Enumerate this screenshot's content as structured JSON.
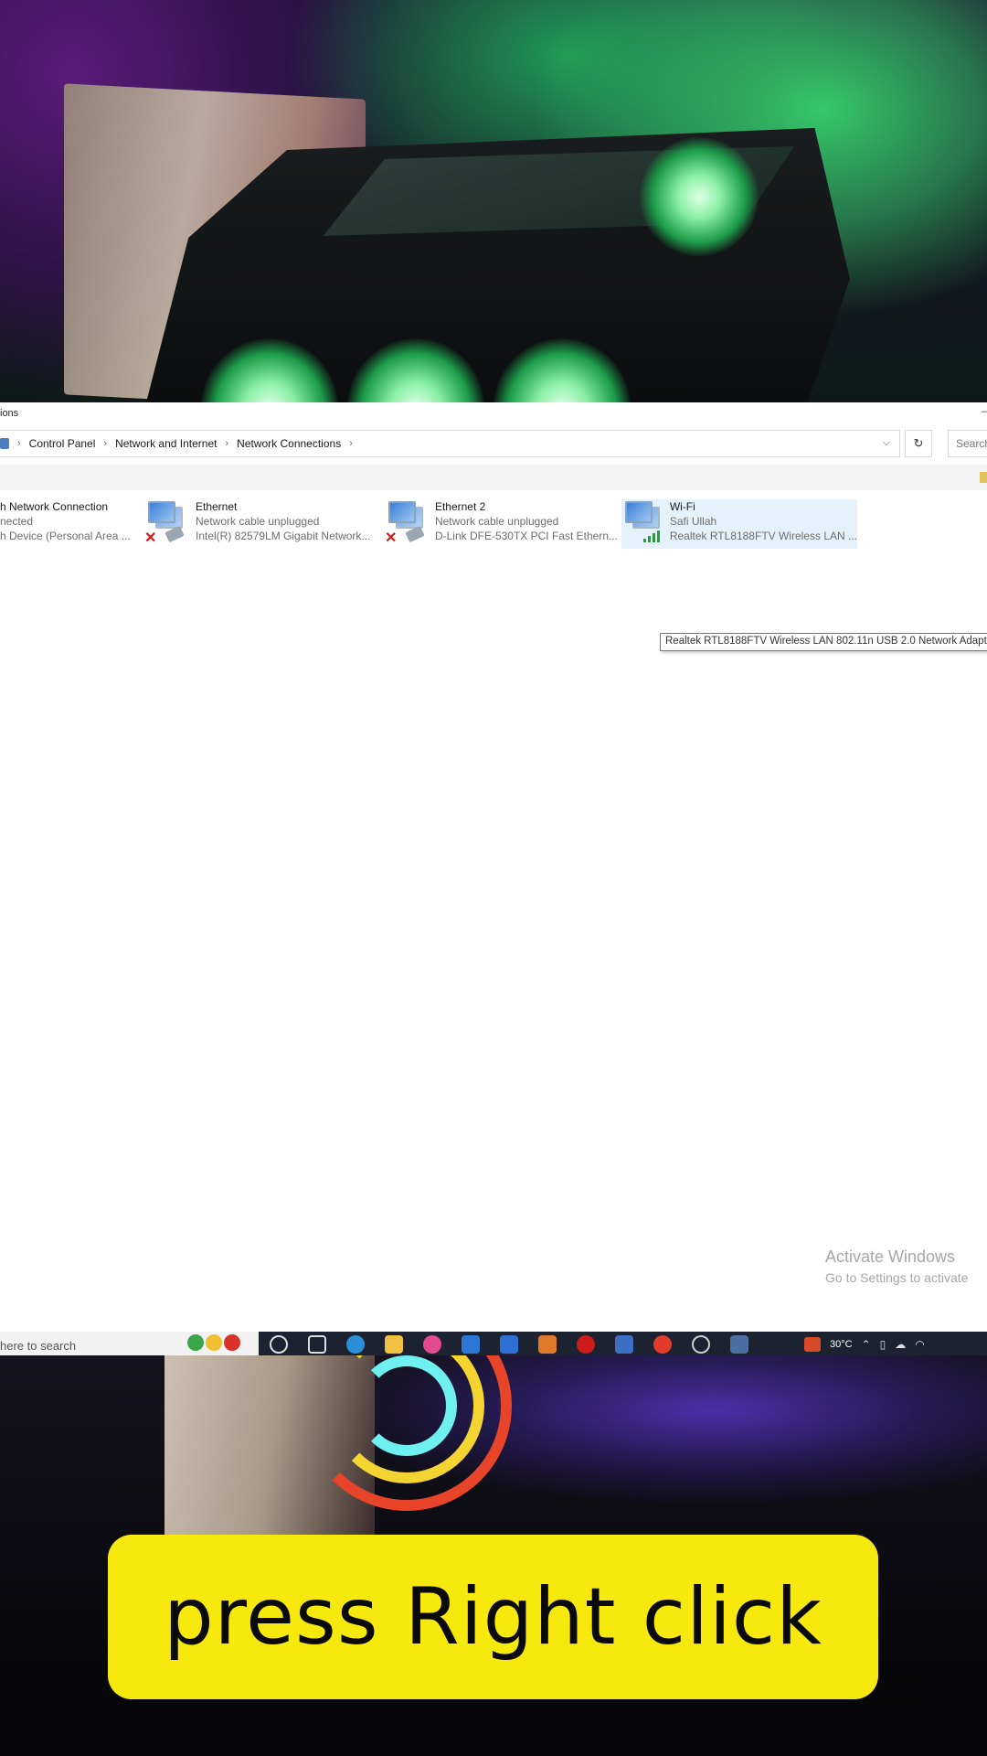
{
  "window": {
    "title_fragment": "ions"
  },
  "address_bar": {
    "crumbs": [
      "Control Panel",
      "Network and Internet",
      "Network Connections"
    ],
    "separator": "›",
    "dropdown_icon": "chevron-down-icon",
    "refresh_icon": "refresh-icon",
    "search_placeholder": "Search"
  },
  "connections": [
    {
      "name": "h Network Connection",
      "status": "nected",
      "device": "h Device (Personal Area ...",
      "icon": "network-adapter-icon",
      "state": "partial"
    },
    {
      "name": "Ethernet",
      "status": "Network cable unplugged",
      "device": "Intel(R) 82579LM Gigabit Network...",
      "icon": "ethernet-disconnected-icon",
      "state": "disconnected"
    },
    {
      "name": "Ethernet 2",
      "status": "Network cable unplugged",
      "device": "D-Link DFE-530TX PCI Fast Ethern...",
      "icon": "ethernet-disconnected-icon",
      "state": "disconnected"
    },
    {
      "name": "Wi-Fi",
      "status": "Safi Ullah",
      "device": "Realtek RTL8188FTV Wireless LAN ...",
      "icon": "wifi-adapter-icon",
      "state": "connected",
      "selected": true
    }
  ],
  "tooltip": "Realtek RTL8188FTV Wireless LAN 802.11n USB 2.0 Network Adapt",
  "watermark": {
    "line1": "Activate Windows",
    "line2": "Go to Settings to activate"
  },
  "taskbar": {
    "search_text": "here to search",
    "weather": "30°C",
    "colors": {
      "bar": "#1d2230",
      "search_bg": "#f2f2f2"
    }
  },
  "caption": "press Right click",
  "colors": {
    "caption_bg": "#f7e80d",
    "selection": "#e5f1fb",
    "disconnected_x": "#d11b1b",
    "signal_green": "#2d9a3c"
  }
}
